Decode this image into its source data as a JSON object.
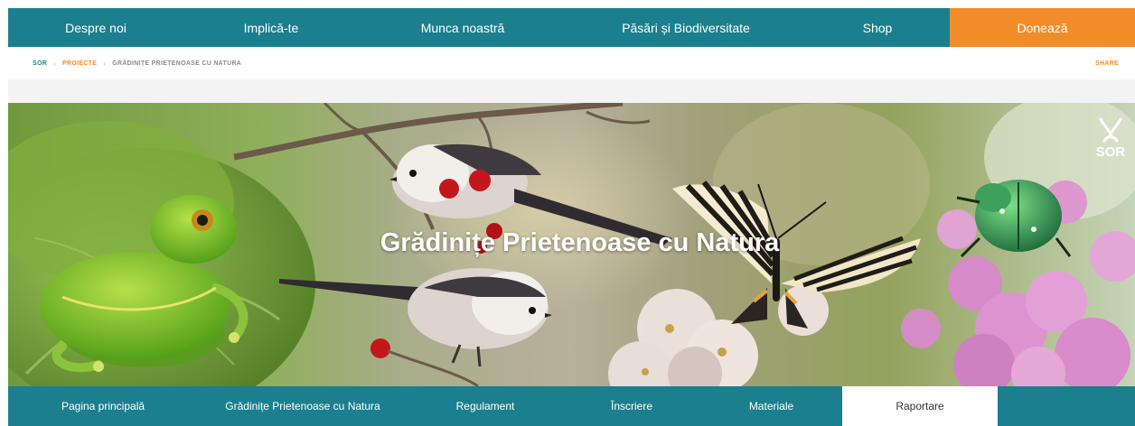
{
  "nav": {
    "items": [
      {
        "label": "Despre noi"
      },
      {
        "label": "Implică-te"
      },
      {
        "label": "Munca noastră"
      },
      {
        "label": "Păsări și Biodiversitate"
      },
      {
        "label": "Shop"
      }
    ],
    "donate_label": "Donează"
  },
  "breadcrumb": {
    "home": "SOR",
    "section": "PROIECTE",
    "current": "GRĂDINIȚE PRIETENOASE CU NATURA",
    "separator": "›"
  },
  "share_label": "SHARE",
  "hero": {
    "title": "Grădinițe Prietenoase cu Natura",
    "logo_text": "SOR"
  },
  "subnav": {
    "items": [
      {
        "label": "Pagina principală"
      },
      {
        "label": "Grădinițe Prietenoase cu Natura"
      },
      {
        "label": "Regulament"
      },
      {
        "label": "Înscriere"
      },
      {
        "label": "Materiale"
      },
      {
        "label": "Raportare"
      }
    ],
    "active_index": 5
  },
  "colors": {
    "nav_bg": "#1b7f8e",
    "donate_bg": "#f28c28",
    "accent": "#f28c28",
    "active_tab_bg": "#ffffff"
  }
}
